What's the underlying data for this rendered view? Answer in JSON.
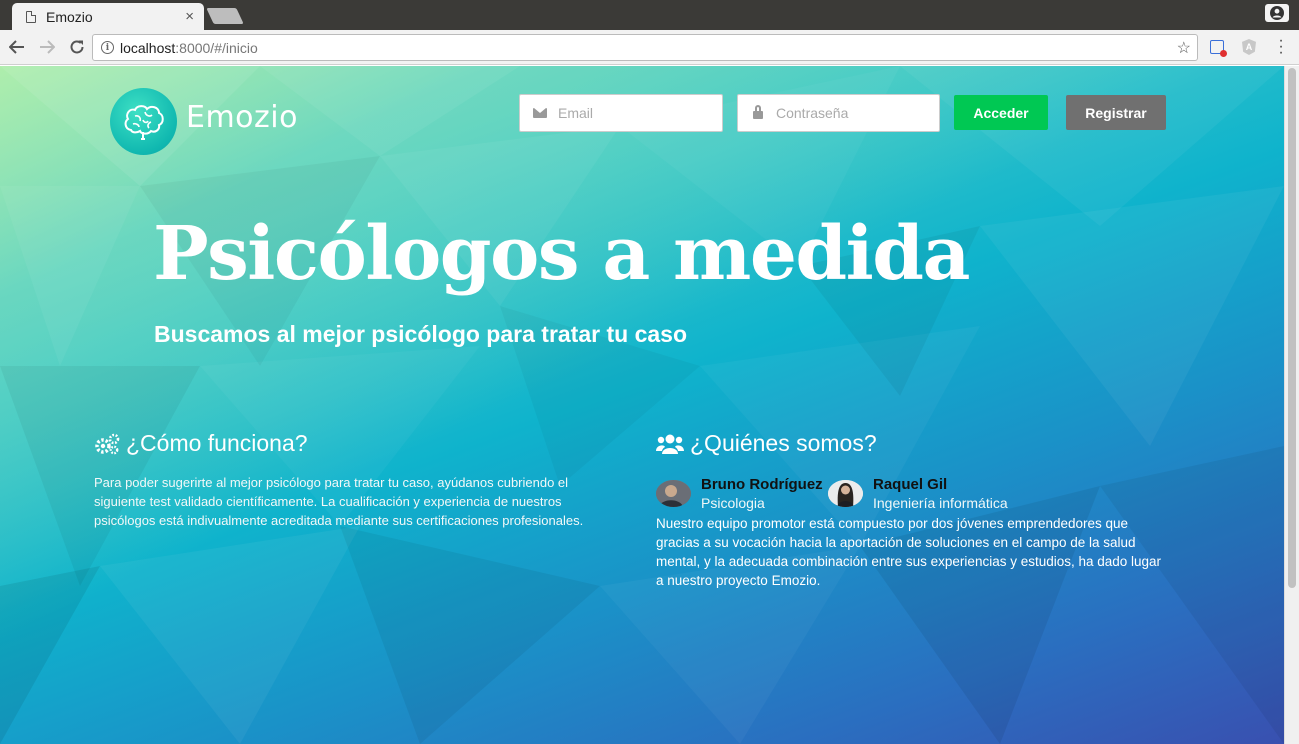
{
  "browser": {
    "tab_title": "Emozio",
    "tab_close": "×",
    "url_host": "localhost",
    "url_rest": ":8000/#/inicio"
  },
  "header": {
    "brand": "Emozio",
    "email_placeholder": "Email",
    "password_placeholder": "Contraseña",
    "login_label": "Acceder",
    "register_label": "Registrar"
  },
  "hero": {
    "title": "Psicólogos a medida",
    "subtitle": "Buscamos al mejor psicólogo para tratar tu caso"
  },
  "how": {
    "title": "¿Cómo funciona?",
    "icon": "gears-icon",
    "text": "Para poder sugerirte al mejor psicólogo para tratar tu caso, ayúdanos cubriendo el siguiente test validado científicamente. La cualificación y experiencia de nuestros psicólogos está indivualmente acreditada mediante sus certificaciones profesionales."
  },
  "who": {
    "title": "¿Quiénes somos?",
    "icon": "users-icon",
    "members": [
      {
        "name": "Bruno Rodríguez",
        "role": "Psicologia"
      },
      {
        "name": "Raquel Gil",
        "role": "Ingeniería informática"
      }
    ],
    "text": "Nuestro equipo promotor está compuesto por dos jóvenes emprendedores que gracias a su vocación hacia la aportación de soluciones en el campo de la salud mental, y la adecuada combinación entre sus experiencias y estudios, ha dado lugar a nuestro proyecto Emozio."
  },
  "colors": {
    "login_button": "#00c853",
    "register_button": "#707070",
    "background_top": "#8ee0b8",
    "background_bottom": "#3950b0"
  }
}
